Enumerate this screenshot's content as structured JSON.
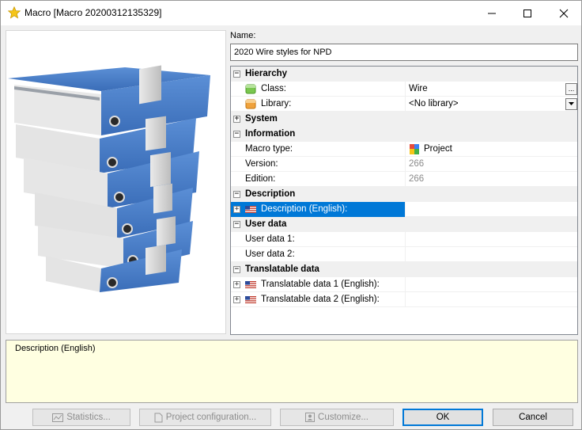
{
  "window": {
    "title": "Macro [Macro 20200312135329]",
    "icon": "star-icon",
    "controls": [
      "minimize-icon",
      "maximize-icon",
      "close-icon"
    ]
  },
  "preview": {
    "description": "Stack of blue ring binders"
  },
  "name_field": {
    "label": "Name:",
    "value": "2020 Wire styles for NPD"
  },
  "grid": {
    "hierarchy": {
      "label": "Hierarchy",
      "class": {
        "name": "Class:",
        "value": "Wire",
        "button": "..."
      },
      "library": {
        "name": "Library:",
        "value": "<No library>"
      }
    },
    "system": {
      "label": "System"
    },
    "information": {
      "label": "Information",
      "macro_type": {
        "name": "Macro type:",
        "value": "Project"
      },
      "version": {
        "name": "Version:",
        "value": "266"
      },
      "edition": {
        "name": "Edition:",
        "value": "266"
      }
    },
    "description": {
      "label": "Description",
      "english": {
        "name": "Description (English):",
        "value": ""
      }
    },
    "user_data": {
      "label": "User data",
      "data1": {
        "name": "User data 1:",
        "value": ""
      },
      "data2": {
        "name": "User data 2:",
        "value": ""
      }
    },
    "translatable": {
      "label": "Translatable data",
      "data1": {
        "name": "Translatable data 1 (English):",
        "value": ""
      },
      "data2": {
        "name": "Translatable data 2 (English):",
        "value": ""
      }
    }
  },
  "description_box": {
    "title": "Description (English)"
  },
  "buttons": {
    "statistics": "Statistics...",
    "project_configuration": "Project configuration...",
    "customize": "Customize...",
    "ok": "OK",
    "cancel": "Cancel"
  },
  "colors": {
    "selection": "#0078d7",
    "description_bg": "#ffffe1"
  }
}
